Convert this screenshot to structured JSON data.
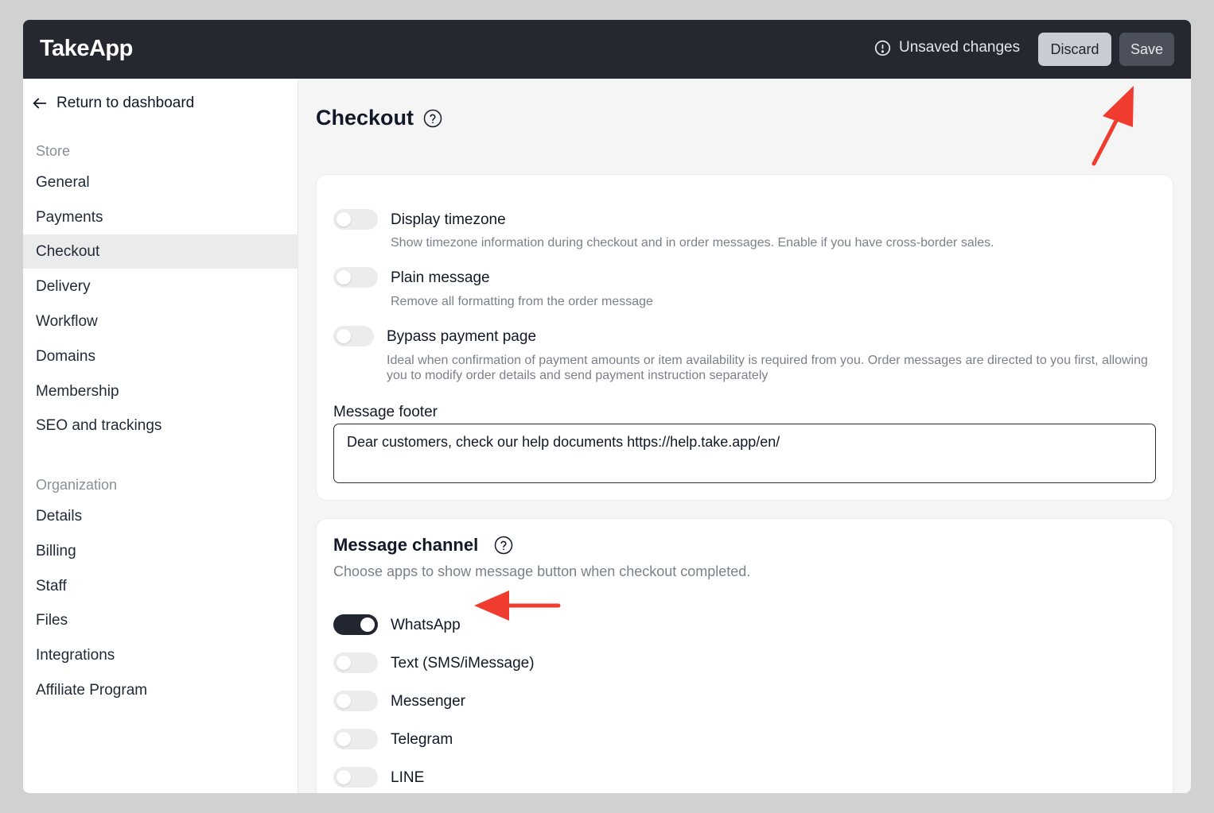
{
  "app": {
    "logo": "TakeApp"
  },
  "topbar": {
    "unsaved_label": "Unsaved changes",
    "discard_label": "Discard",
    "save_label": "Save"
  },
  "sidebar": {
    "return_label": "Return to dashboard",
    "store_title": "Store",
    "store_items": [
      "General",
      "Payments",
      "Checkout",
      "Delivery",
      "Workflow",
      "Domains",
      "Membership",
      "SEO and trackings"
    ],
    "active_item": "Checkout",
    "org_title": "Organization",
    "org_items": [
      "Details",
      "Billing",
      "Staff",
      "Files",
      "Integrations",
      "Affiliate Program"
    ]
  },
  "main": {
    "title": "Checkout",
    "options": [
      {
        "label": "Display timezone",
        "description": "Show timezone information during checkout and in order messages. Enable if you have cross-border sales.",
        "enabled": false
      },
      {
        "label": "Plain message",
        "description": "Remove all formatting from the order message",
        "enabled": false
      },
      {
        "label": "Bypass payment page",
        "description": "Ideal when confirmation of payment amounts or item availability is required from you. Order messages are directed to you first, allowing you to modify order details and send payment instruction separately",
        "enabled": false
      }
    ],
    "footer_label": "Message footer",
    "footer_value": "Dear customers, check our help documents https://help.take.app/en/",
    "channel": {
      "title": "Message channel",
      "subtitle": "Choose apps to show message button when checkout completed.",
      "items": [
        {
          "label": "WhatsApp",
          "enabled": true
        },
        {
          "label": "Text (SMS/iMessage)",
          "enabled": false
        },
        {
          "label": "Messenger",
          "enabled": false
        },
        {
          "label": "Telegram",
          "enabled": false
        },
        {
          "label": "LINE",
          "enabled": false
        }
      ]
    }
  },
  "colors": {
    "topbar": "#252830",
    "toggle_on": "#222630",
    "annotation_arrow": "#f03c2e"
  },
  "icons": [
    "alert-circle-icon",
    "arrow-left-icon",
    "help-circle-icon"
  ]
}
